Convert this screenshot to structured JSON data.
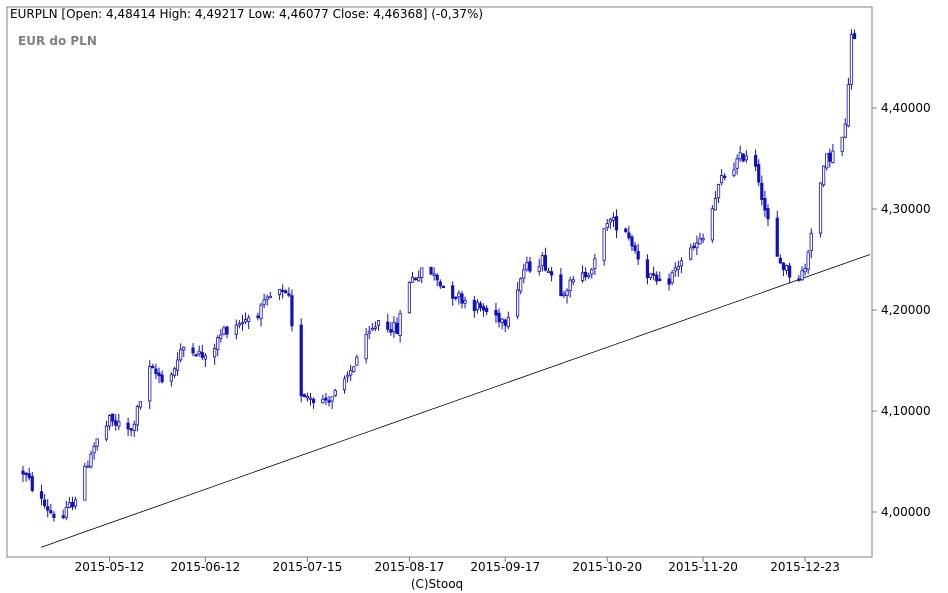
{
  "header": {
    "symbol": "EURPLN",
    "ohlc_text": "EURPLN [Open: 4,48414  High: 4,49217  Low: 4,46077  Close: 4,46368]  (-0,37%)"
  },
  "subtitle": "EUR do PLN",
  "footer": {
    "credit": "(C)Stooq"
  },
  "colors": {
    "candle": "#1010c0",
    "axis": "#808080",
    "trendline": "#000000",
    "background": "#ffffff"
  },
  "chart_data": {
    "type": "candlestick",
    "x_tick_labels": [
      "2015-05-12",
      "2015-06-12",
      "2015-07-15",
      "2015-08-17",
      "2015-09-17",
      "2015-10-20",
      "2015-11-20",
      "2015-12-23"
    ],
    "y_tick_labels": [
      "4,40000",
      "4,30000",
      "4,20000",
      "4,10000",
      "4,00000"
    ],
    "y_ticks": [
      4.4,
      4.3,
      4.2,
      4.1,
      4.0
    ],
    "ylim": [
      3.96,
      4.5
    ],
    "x_range_days": [
      "2015-04-14",
      "2016-01-13"
    ],
    "grid": false,
    "trendline": {
      "start": [
        "2015-04-14",
        3.965
      ],
      "end": [
        "2016-01-13",
        4.255
      ]
    },
    "anchors": [
      [
        "2015-04-14",
        4.04
      ],
      [
        "2015-04-20",
        4.01
      ],
      [
        "2015-04-26",
        3.99
      ],
      [
        "2015-05-02",
        4.02
      ],
      [
        "2015-05-06",
        4.06
      ],
      [
        "2015-05-12",
        4.09
      ],
      [
        "2015-05-19",
        4.08
      ],
      [
        "2015-05-25",
        4.14
      ],
      [
        "2015-05-31",
        4.13
      ],
      [
        "2015-06-06",
        4.17
      ],
      [
        "2015-06-12",
        4.15
      ],
      [
        "2015-06-18",
        4.18
      ],
      [
        "2015-06-24",
        4.19
      ],
      [
        "2015-06-30",
        4.2
      ],
      [
        "2015-07-05",
        4.22
      ],
      [
        "2015-07-09",
        4.21
      ],
      [
        "2015-07-12",
        4.12
      ],
      [
        "2015-07-20",
        4.11
      ],
      [
        "2015-07-26",
        4.12
      ],
      [
        "2015-08-01",
        4.16
      ],
      [
        "2015-08-07",
        4.19
      ],
      [
        "2015-08-13",
        4.18
      ],
      [
        "2015-08-17",
        4.23
      ],
      [
        "2015-08-23",
        4.24
      ],
      [
        "2015-08-29",
        4.22
      ],
      [
        "2015-09-04",
        4.21
      ],
      [
        "2015-09-10",
        4.2
      ],
      [
        "2015-09-17",
        4.19
      ],
      [
        "2015-09-23",
        4.24
      ],
      [
        "2015-09-29",
        4.25
      ],
      [
        "2015-10-05",
        4.22
      ],
      [
        "2015-10-11",
        4.23
      ],
      [
        "2015-10-17",
        4.25
      ],
      [
        "2015-10-20",
        4.29
      ],
      [
        "2015-10-26",
        4.28
      ],
      [
        "2015-11-01",
        4.24
      ],
      [
        "2015-11-07",
        4.22
      ],
      [
        "2015-11-13",
        4.25
      ],
      [
        "2015-11-20",
        4.27
      ],
      [
        "2015-11-26",
        4.33
      ],
      [
        "2015-12-02",
        4.35
      ],
      [
        "2015-12-06",
        4.36
      ],
      [
        "2015-12-10",
        4.3
      ],
      [
        "2015-12-14",
        4.25
      ],
      [
        "2015-12-20",
        4.23
      ],
      [
        "2015-12-23",
        4.24
      ],
      [
        "2015-12-26",
        4.3
      ],
      [
        "2015-12-30",
        4.35
      ],
      [
        "2016-01-03",
        4.36
      ],
      [
        "2016-01-05",
        4.38
      ],
      [
        "2016-01-07",
        4.47
      ],
      [
        "2016-01-08",
        4.464
      ]
    ]
  }
}
